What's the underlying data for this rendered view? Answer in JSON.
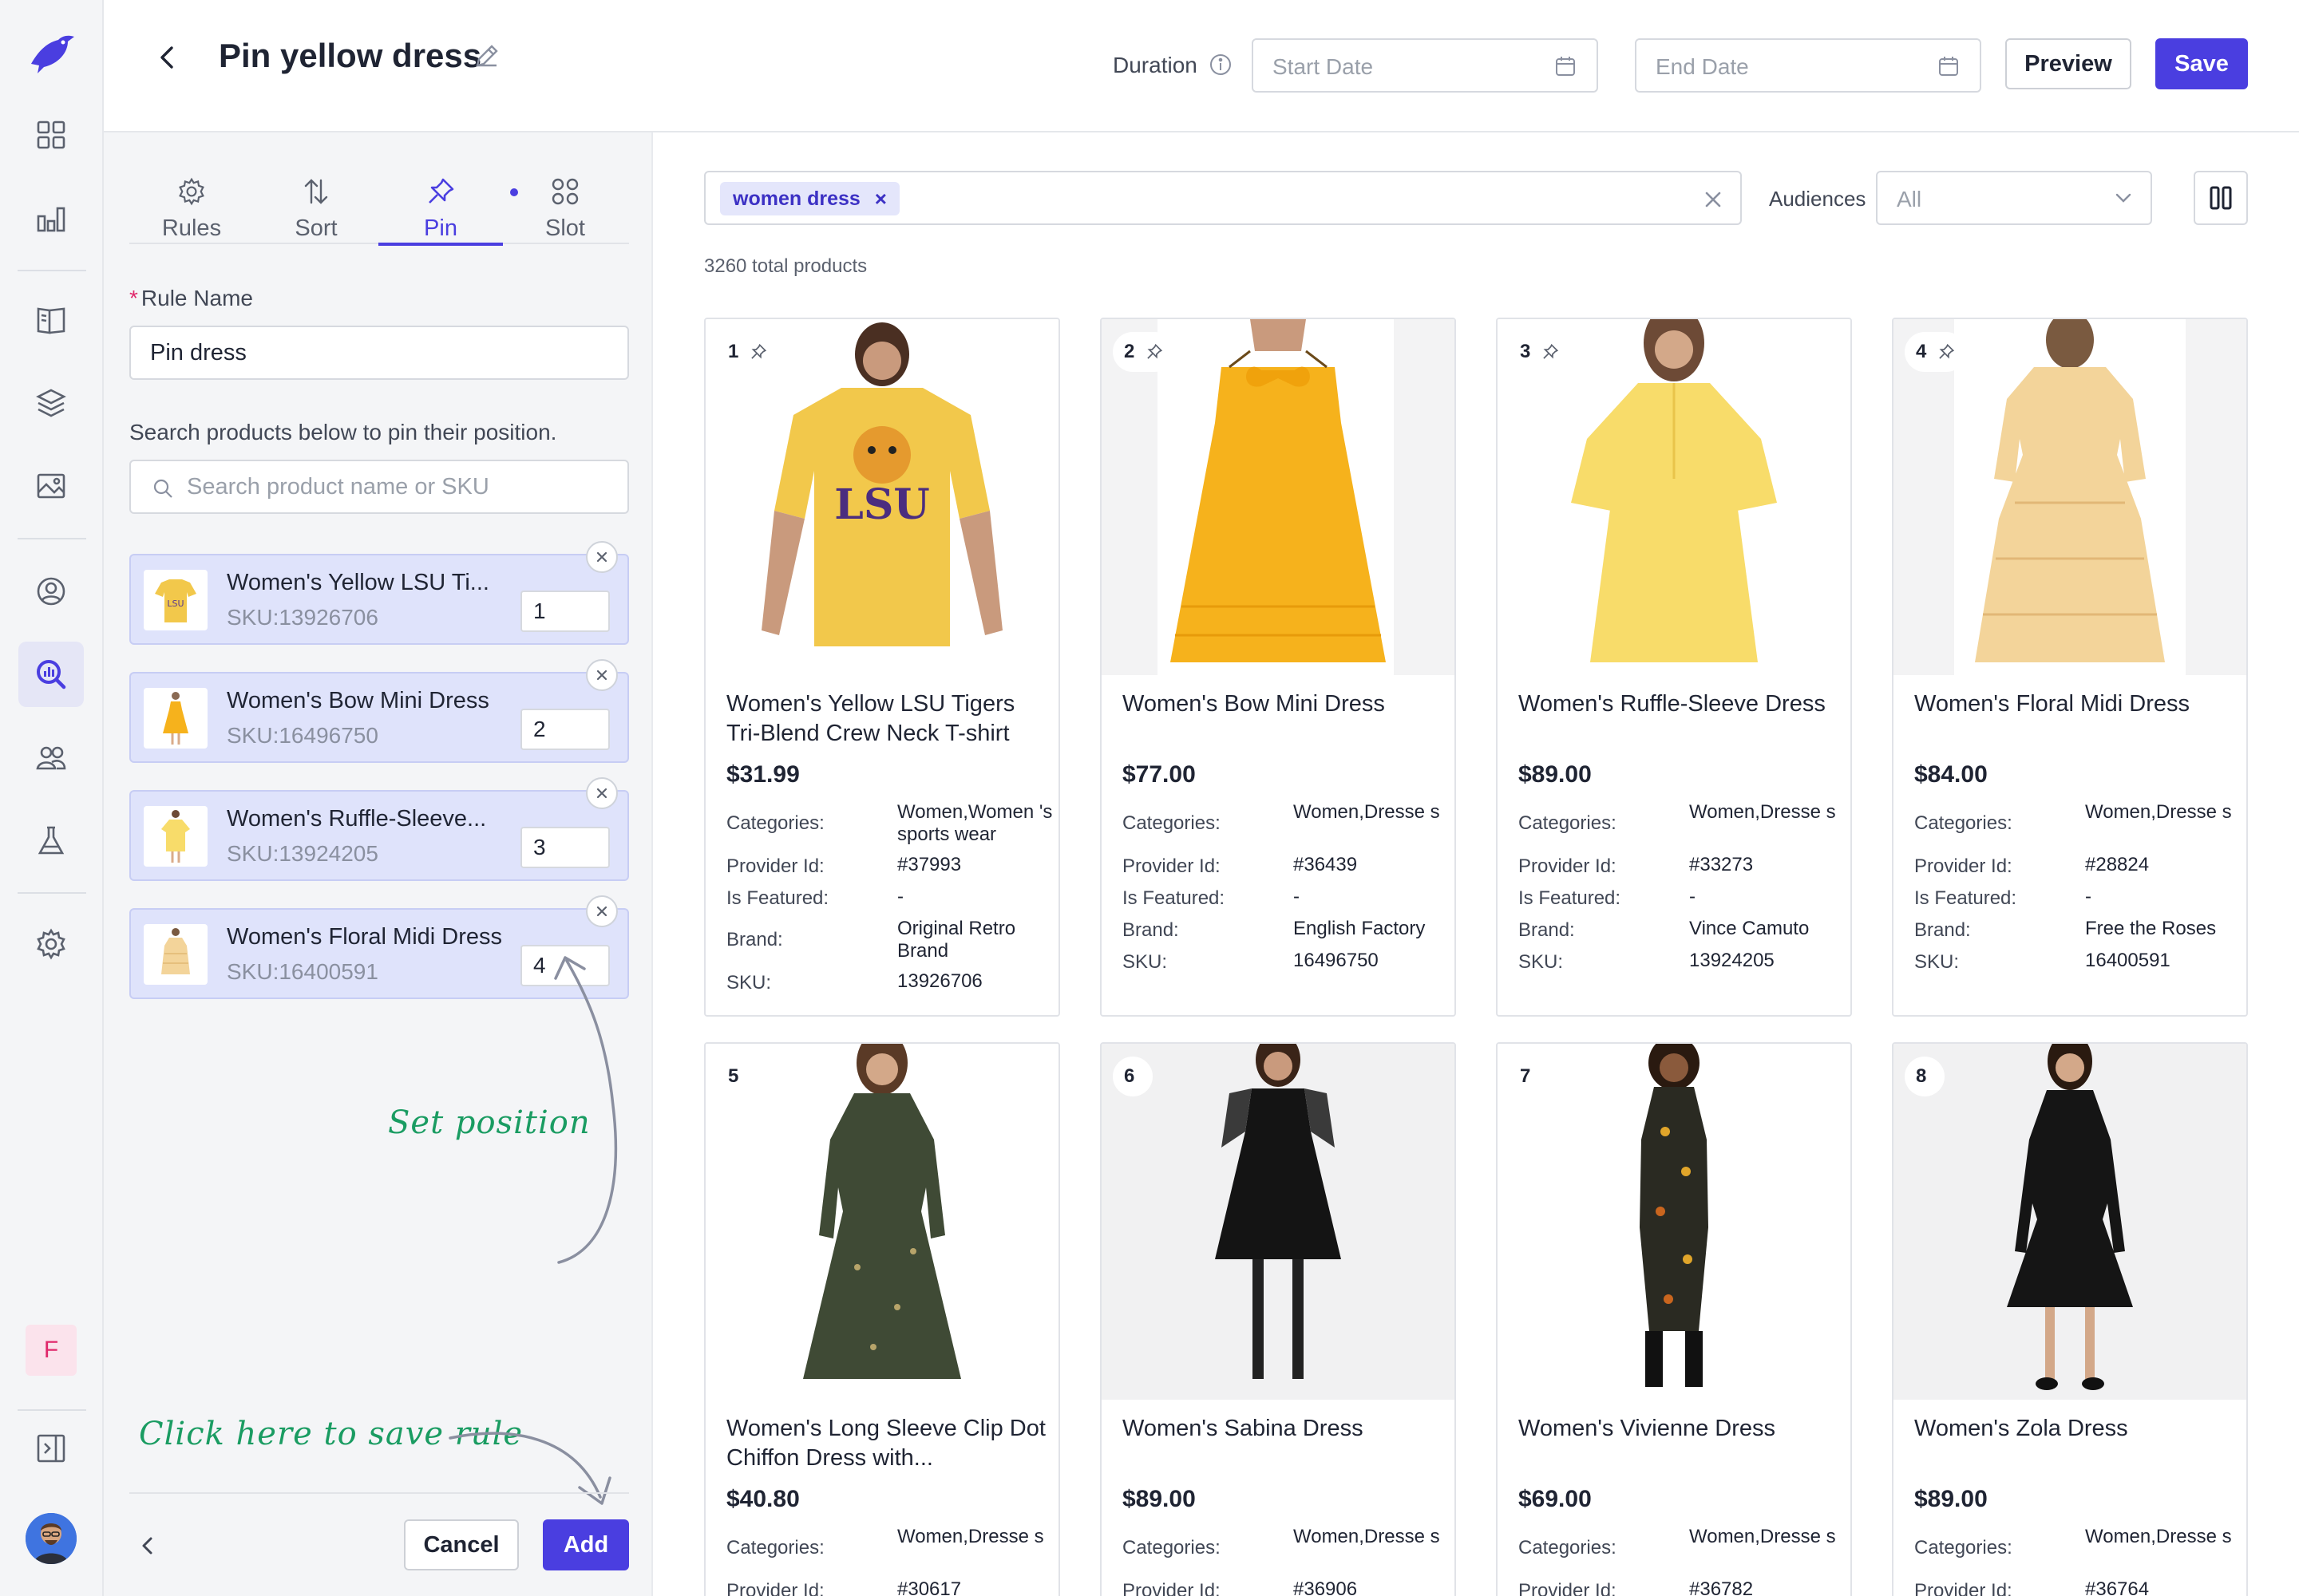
{
  "header": {
    "title": "Pin yellow dress",
    "duration_label": "Duration",
    "start_placeholder": "Start Date",
    "end_placeholder": "End Date",
    "preview_label": "Preview",
    "save_label": "Save"
  },
  "rail": {
    "badge_letter": "F",
    "icons": [
      "logo-bird-icon",
      "dashboard-icon",
      "analytics-icon",
      "catalog-icon",
      "layers-icon",
      "image-icon",
      "user-circle-icon",
      "search-analytics-icon",
      "users-icon",
      "flask-icon",
      "gear-icon",
      "collapse-panel-icon"
    ]
  },
  "panel": {
    "tabs": [
      {
        "label": "Rules",
        "icon": "gear-icon"
      },
      {
        "label": "Sort",
        "icon": "sort-icon"
      },
      {
        "label": "Pin",
        "icon": "pin-icon"
      },
      {
        "label": "Slot",
        "icon": "slot-icon"
      }
    ],
    "active_tab": "Pin",
    "rule_name_label": "Rule Name",
    "rule_name_value": "Pin dress",
    "search_hint": "Search products below to pin their position.",
    "search_placeholder": "Search product name or SKU",
    "pinned": [
      {
        "name": "Women's Yellow LSU Ti...",
        "sku": "SKU:13926706",
        "position": "1"
      },
      {
        "name": "Women's Bow Mini Dress",
        "sku": "SKU:16496750",
        "position": "2"
      },
      {
        "name": "Women's Ruffle-Sleeve...",
        "sku": "SKU:13924205",
        "position": "3"
      },
      {
        "name": "Women's Floral Midi Dress",
        "sku": "SKU:16400591",
        "position": "4"
      }
    ],
    "hint_set_position": "Set position",
    "hint_save_rule": "Click here to save rule",
    "cancel_label": "Cancel",
    "add_label": "Add"
  },
  "main": {
    "filter_chip": "women dress",
    "audiences_label": "Audiences",
    "audiences_value": "All",
    "total_products": "3260 total products",
    "attr_labels": {
      "categories": "Categories:",
      "provider": "Provider Id:",
      "featured": "Is Featured:",
      "brand": "Brand:",
      "sku": "SKU:"
    },
    "products": [
      {
        "pos": "1",
        "pinned": true,
        "name": "Women's Yellow LSU Tigers Tri-Blend Crew Neck T-shirt",
        "price": "$31.99",
        "categories": "Women,Women 's sports wear",
        "provider": "#37993",
        "featured": "-",
        "brand": "Original Retro Brand",
        "sku": "13926706"
      },
      {
        "pos": "2",
        "pinned": true,
        "name": "Women's Bow Mini Dress",
        "price": "$77.00",
        "categories": "Women,Dresse s",
        "provider": "#36439",
        "featured": "-",
        "brand": "English Factory",
        "sku": "16496750"
      },
      {
        "pos": "3",
        "pinned": true,
        "name": "Women's Ruffle-Sleeve Dress",
        "price": "$89.00",
        "categories": "Women,Dresse s",
        "provider": "#33273",
        "featured": "-",
        "brand": "Vince Camuto",
        "sku": "13924205"
      },
      {
        "pos": "4",
        "pinned": true,
        "name": "Women's Floral Midi Dress",
        "price": "$84.00",
        "categories": "Women,Dresse s",
        "provider": "#28824",
        "featured": "-",
        "brand": "Free the Roses",
        "sku": "16400591"
      },
      {
        "pos": "5",
        "pinned": false,
        "name": "Women's Long Sleeve Clip Dot Chiffon Dress with...",
        "price": "$40.80",
        "categories": "Women,Dresse s",
        "provider": "#30617"
      },
      {
        "pos": "6",
        "pinned": false,
        "name": "Women's Sabina Dress",
        "price": "$89.00",
        "categories": "Women,Dresse s",
        "provider": "#36906"
      },
      {
        "pos": "7",
        "pinned": false,
        "name": "Women's Vivienne Dress",
        "price": "$69.00",
        "categories": "Women,Dresse s",
        "provider": "#36782"
      },
      {
        "pos": "8",
        "pinned": false,
        "name": "Women's Zola Dress",
        "price": "$89.00",
        "categories": "Women,Dresse s",
        "provider": "#36764"
      }
    ]
  },
  "colors": {
    "accent": "#4a3ee0",
    "pinned_bg": "#dfe3fb",
    "hint_green": "#1a9c62",
    "panel_bg": "#f4f5f7"
  }
}
